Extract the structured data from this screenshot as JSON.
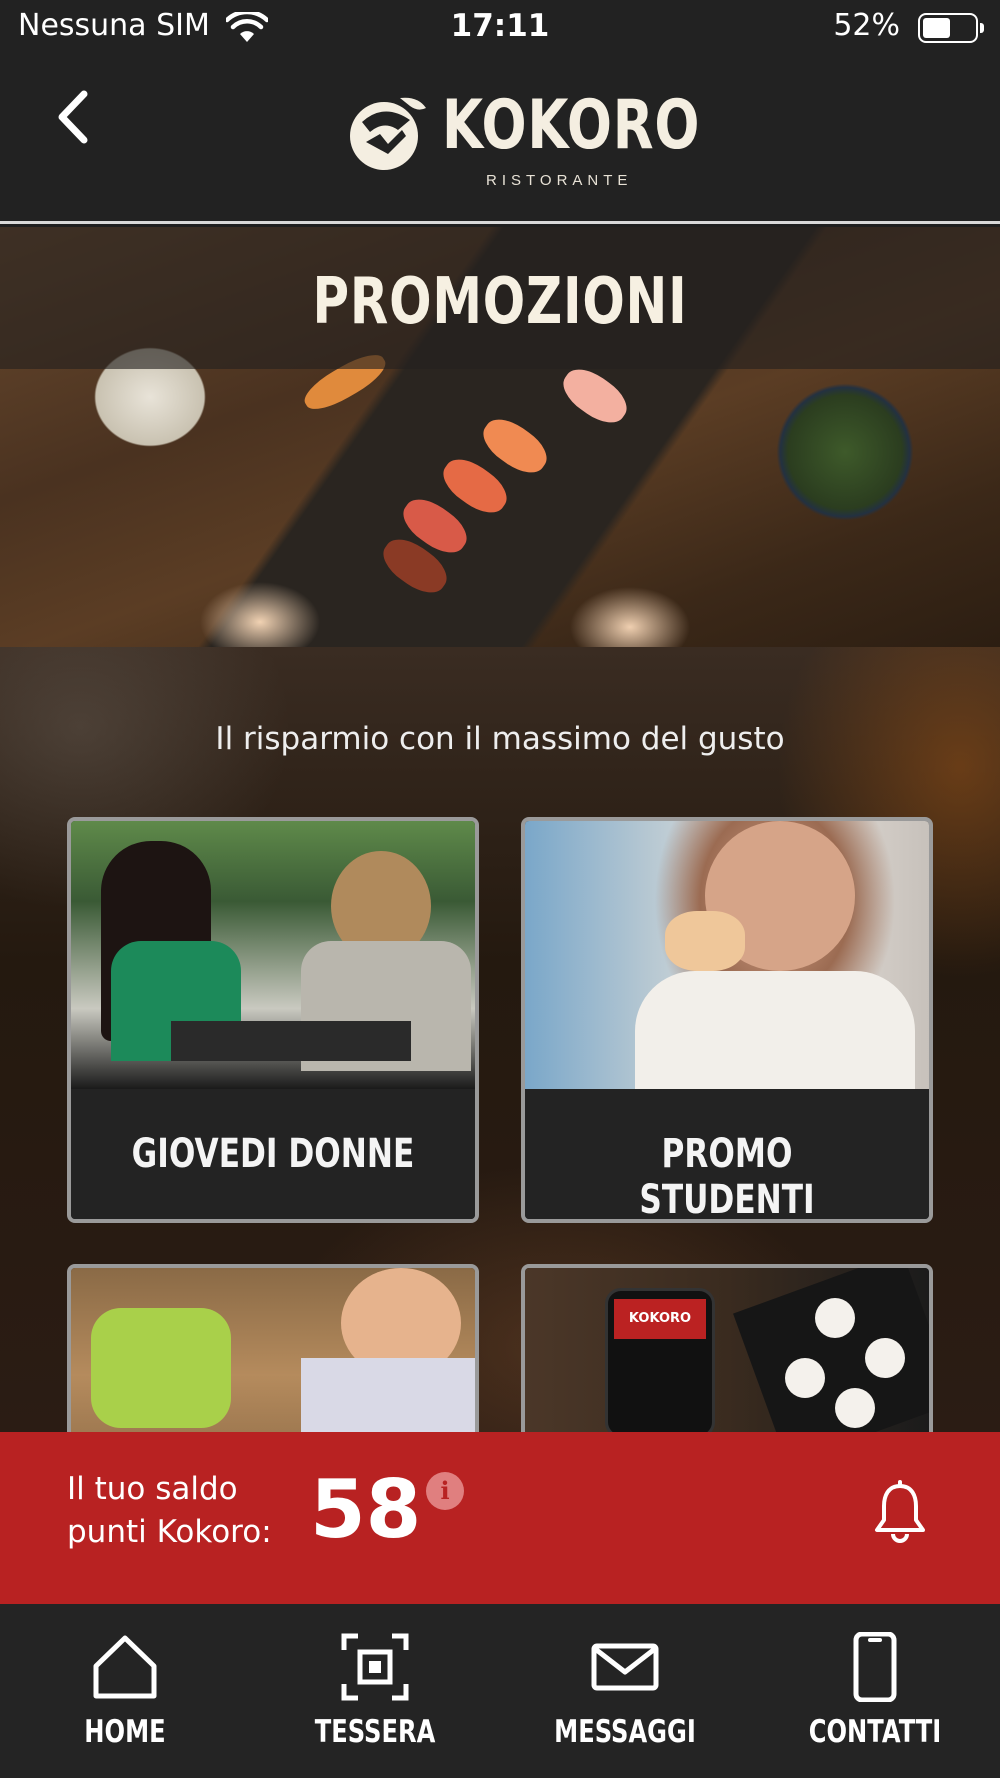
{
  "status_bar": {
    "carrier": "Nessuna SIM",
    "time": "17:11",
    "battery": "52%"
  },
  "header": {
    "brand": "KOKORO",
    "brand_sub": "RISTORANTE"
  },
  "banner": {
    "title": "PROMOZIONI"
  },
  "tagline": "Il risparmio con il massimo del gusto",
  "promos": [
    {
      "label": "GIOVEDI DONNE"
    },
    {
      "label": "PROMO STUDENTI"
    },
    {
      "label": ""
    },
    {
      "label": ""
    }
  ],
  "phone_mock_brand": "KOKORO",
  "points": {
    "label": "Il tuo saldo punti Kokoro:",
    "value": "58"
  },
  "tabs": [
    {
      "label": "HOME",
      "icon": "home-icon"
    },
    {
      "label": "TESSERA",
      "icon": "scan-icon"
    },
    {
      "label": "MESSAGGI",
      "icon": "mail-icon"
    },
    {
      "label": "CONTATTI",
      "icon": "phone-icon"
    }
  ],
  "colors": {
    "dark_bg": "#222222",
    "accent_red": "#b82222",
    "card_border": "#9a9a9a",
    "cream": "#f4eee1"
  }
}
